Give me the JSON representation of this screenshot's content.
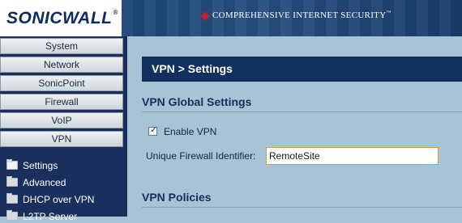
{
  "header": {
    "logo_text": "SONICWALL",
    "logo_mark": "®",
    "tagline": "COMPREHENSIVE INTERNET SECURITY",
    "tagline_mark": "™"
  },
  "sidebar": {
    "nav_buttons": [
      "System",
      "Network",
      "SonicPoint",
      "Firewall",
      "VoIP",
      "VPN"
    ],
    "sub_items": [
      {
        "label": "Settings",
        "icon": "folder-open-icon",
        "active": true
      },
      {
        "label": "Advanced",
        "icon": "folder-icon"
      },
      {
        "label": "DHCP over VPN",
        "icon": "folder-icon"
      },
      {
        "label": "L2TP Server",
        "icon": "folder-icon"
      }
    ]
  },
  "main": {
    "page_title": "VPN > Settings",
    "global_section_title": "VPN Global Settings",
    "enable_vpn_label": "Enable VPN",
    "enable_vpn_checked": true,
    "identifier_label": "Unique Firewall Identifier:",
    "identifier_value": "RemoteSite",
    "policies_section_title": "VPN Policies"
  },
  "colors": {
    "sidebar_bg": "#1b2f5e",
    "title_bar": "#12305e",
    "content_bg": "#a9c3d6",
    "input_border": "#d99a3b"
  }
}
